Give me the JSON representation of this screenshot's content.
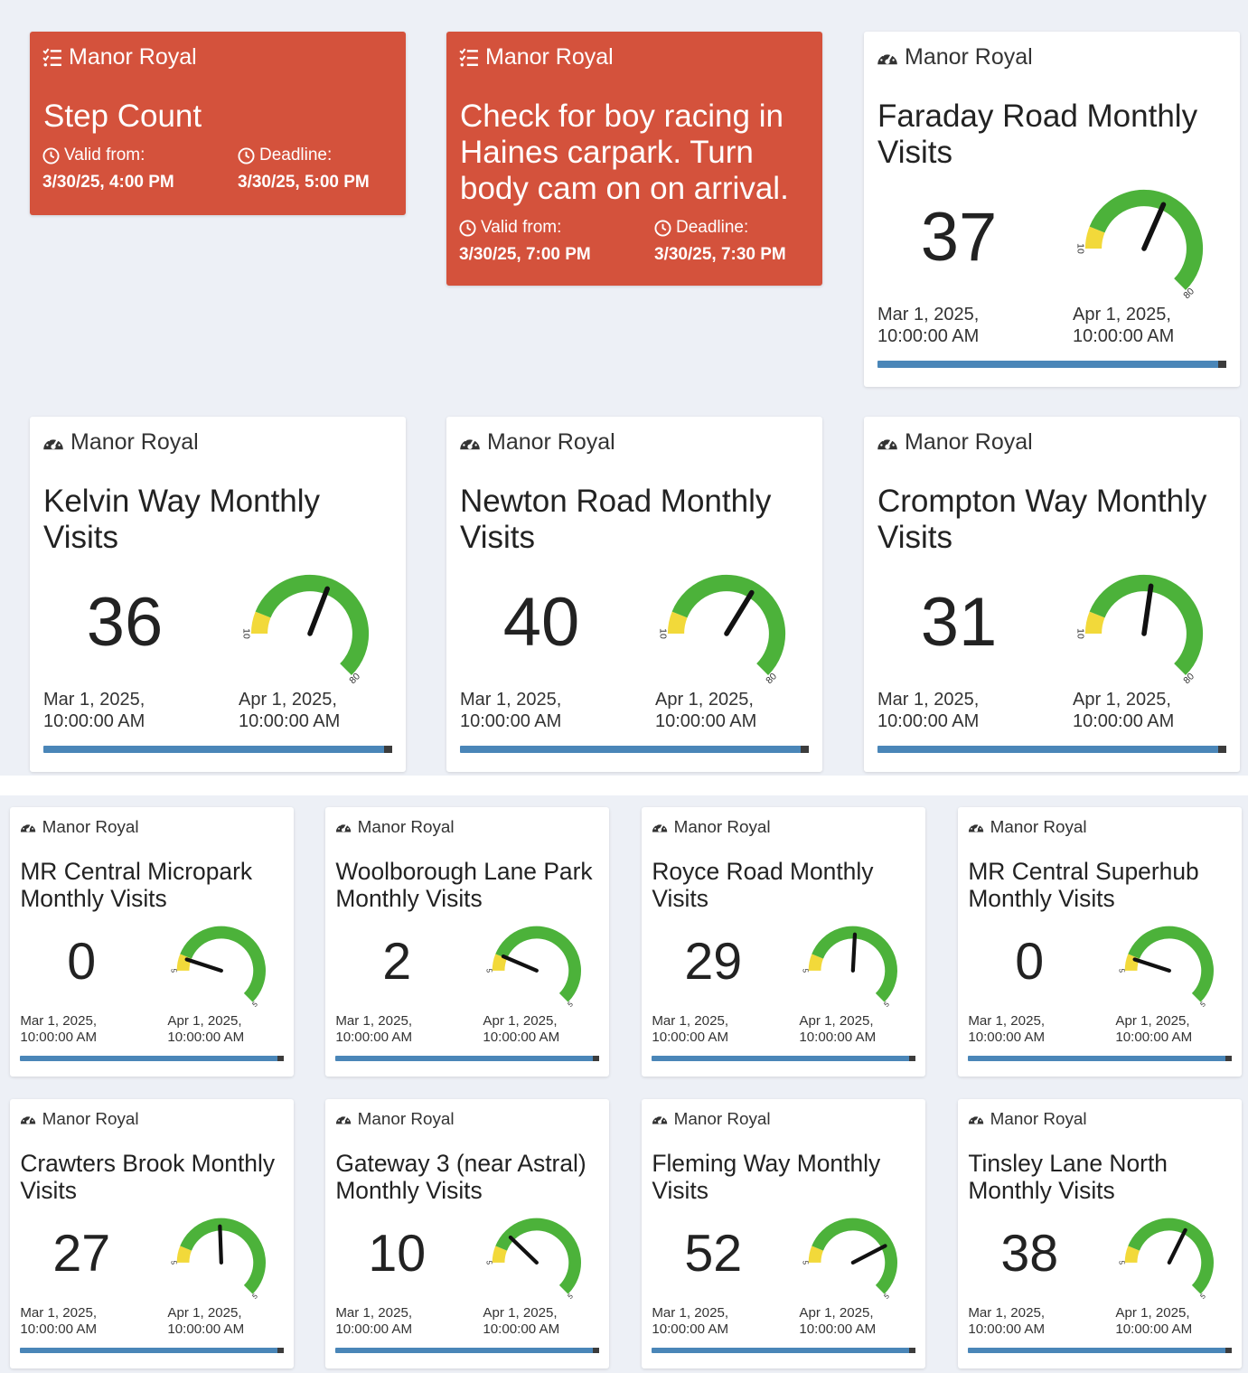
{
  "colors": {
    "task_bg": "#d4523c",
    "page_bg": "#edf0f6",
    "gauge_green": "#4cb23a",
    "gauge_yellow": "#f2d93a",
    "progress_blue": "#4a86b8"
  },
  "tasks": [
    {
      "site": "Manor Royal",
      "icon": "list-check-icon",
      "title": "Step Count",
      "valid_from_label": "Valid from:",
      "valid_from": "3/30/25, 4:00 PM",
      "deadline_label": "Deadline:",
      "deadline": "3/30/25, 5:00 PM"
    },
    {
      "site": "Manor Royal",
      "icon": "list-check-icon",
      "title": "Check for boy racing in Haines carpark. Turn body cam on on arrival.",
      "valid_from_label": "Valid from:",
      "valid_from": "3/30/25, 7:00 PM",
      "deadline_label": "Deadline:",
      "deadline": "3/30/25, 7:30 PM"
    }
  ],
  "meters": [
    {
      "site": "Manor Royal",
      "icon": "gauge-icon",
      "title": "Faraday Road Monthly Visits",
      "value": "37",
      "gauge_min_label": "10",
      "gauge_max_label": "80",
      "start": "Mar 1, 2025,",
      "start_time": "10:00:00 AM",
      "end": "Apr 1, 2025,",
      "end_time": "10:00:00 AM",
      "progress": 1.0
    },
    {
      "site": "Manor Royal",
      "icon": "gauge-icon",
      "title": "Kelvin Way Monthly Visits",
      "value": "36",
      "gauge_min_label": "10",
      "gauge_max_label": "80",
      "start": "Mar 1, 2025,",
      "start_time": "10:00:00 AM",
      "end": "Apr 1, 2025,",
      "end_time": "10:00:00 AM",
      "progress": 1.0
    },
    {
      "site": "Manor Royal",
      "icon": "gauge-icon",
      "title": "Newton Road Monthly Visits",
      "value": "40",
      "gauge_min_label": "10",
      "gauge_max_label": "80",
      "start": "Mar 1, 2025,",
      "start_time": "10:00:00 AM",
      "end": "Apr 1, 2025,",
      "end_time": "10:00:00 AM",
      "progress": 1.0
    },
    {
      "site": "Manor Royal",
      "icon": "gauge-icon",
      "title": "Crompton Way Monthly Visits",
      "value": "31",
      "gauge_min_label": "10",
      "gauge_max_label": "80",
      "start": "Mar 1, 2025,",
      "start_time": "10:00:00 AM",
      "end": "Apr 1, 2025,",
      "end_time": "10:00:00 AM",
      "progress": 1.0
    },
    {
      "site": "Manor Royal",
      "icon": "gauge-icon",
      "title": "MR Central Micropark Monthly Visits",
      "value": "0",
      "gauge_min_label": "5",
      "gauge_max_label": "5",
      "start": "Mar 1, 2025,",
      "start_time": "10:00:00 AM",
      "end": "Apr 1, 2025,",
      "end_time": "10:00:00 AM",
      "progress": 1.0
    },
    {
      "site": "Manor Royal",
      "icon": "gauge-icon",
      "title": "Woolborough Lane Park Monthly Visits",
      "value": "2",
      "gauge_min_label": "5",
      "gauge_max_label": "5",
      "start": "Mar 1, 2025,",
      "start_time": "10:00:00 AM",
      "end": "Apr 1, 2025,",
      "end_time": "10:00:00 AM",
      "progress": 1.0
    },
    {
      "site": "Manor Royal",
      "icon": "gauge-icon",
      "title": "Royce Road Monthly Visits",
      "value": "29",
      "gauge_min_label": "5",
      "gauge_max_label": "5",
      "start": "Mar 1, 2025,",
      "start_time": "10:00:00 AM",
      "end": "Apr 1, 2025,",
      "end_time": "10:00:00 AM",
      "progress": 1.0
    },
    {
      "site": "Manor Royal",
      "icon": "gauge-icon",
      "title": "MR Central Superhub Monthly Visits",
      "value": "0",
      "gauge_min_label": "5",
      "gauge_max_label": "5",
      "start": "Mar 1, 2025,",
      "start_time": "10:00:00 AM",
      "end": "Apr 1, 2025,",
      "end_time": "10:00:00 AM",
      "progress": 1.0
    },
    {
      "site": "Manor Royal",
      "icon": "gauge-icon",
      "title": "Crawters Brook Monthly Visits",
      "value": "27",
      "gauge_min_label": "5",
      "gauge_max_label": "5",
      "start": "Mar 1, 2025,",
      "start_time": "10:00:00 AM",
      "end": "Apr 1, 2025,",
      "end_time": "10:00:00 AM",
      "progress": 1.0
    },
    {
      "site": "Manor Royal",
      "icon": "gauge-icon",
      "title": "Gateway 3 (near Astral) Monthly Visits",
      "value": "10",
      "gauge_min_label": "5",
      "gauge_max_label": "5",
      "start": "Mar 1, 2025,",
      "start_time": "10:00:00 AM",
      "end": "Apr 1, 2025,",
      "end_time": "10:00:00 AM",
      "progress": 1.0
    },
    {
      "site": "Manor Royal",
      "icon": "gauge-icon",
      "title": "Fleming Way Monthly Visits",
      "value": "52",
      "gauge_min_label": "5",
      "gauge_max_label": "5",
      "start": "Mar 1, 2025,",
      "start_time": "10:00:00 AM",
      "end": "Apr 1, 2025,",
      "end_time": "10:00:00 AM",
      "progress": 1.0
    },
    {
      "site": "Manor Royal",
      "icon": "gauge-icon",
      "title": "Tinsley Lane North Monthly Visits",
      "value": "38",
      "gauge_min_label": "5",
      "gauge_max_label": "5",
      "start": "Mar 1, 2025,",
      "start_time": "10:00:00 AM",
      "end": "Apr 1, 2025,",
      "end_time": "10:00:00 AM",
      "progress": 1.0
    }
  ]
}
